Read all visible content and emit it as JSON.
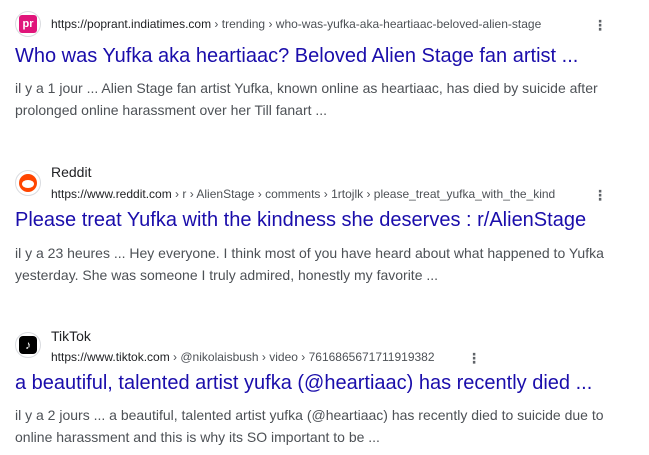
{
  "results": [
    {
      "site_name": "",
      "favicon_text": "pr",
      "url_base": "https://poprant.indiatimes.com",
      "url_path": " › trending › who-was-yufka-aka-heartiaac-beloved-alien-stage",
      "title": "Who was Yufka aka heartiaac? Beloved Alien Stage fan artist ...",
      "snippet": "il y a 1 jour ... Alien Stage fan artist Yufka, known online as heartiaac, has died by suicide after prolonged online harassment over her Till fanart ..."
    },
    {
      "site_name": "Reddit",
      "favicon_text": "",
      "url_base": "https://www.reddit.com",
      "url_path": " › r › AlienStage › comments › 1rtojlk › please_treat_yufka_with_the_kind",
      "title": "Please treat Yufka with the kindness she deserves : r/AlienStage",
      "snippet": "il y a 23 heures ... Hey everyone. I think most of you have heard about what happened to Yufka yesterday. She was someone I truly admired, honestly my favorite ..."
    },
    {
      "site_name": "TikTok",
      "favicon_text": "♪",
      "url_base": "https://www.tiktok.com",
      "url_path": " › @nikolaisbush › video › 7616865671711919382",
      "title": "a beautiful, talented artist yufka (@heartiaac) has recently died ...",
      "snippet": "il y a 2 jours ... a beautiful, talented artist yufka (@heartiaac) has recently died to suicide due to online harassment and this is why its SO important to be ..."
    }
  ],
  "menu_glyph": "⋮",
  "colors": {
    "title_link": "#1a0dab",
    "snippet": "#4d5156",
    "poprant_brand": "#e0157a",
    "reddit_brand": "#ff4500"
  }
}
